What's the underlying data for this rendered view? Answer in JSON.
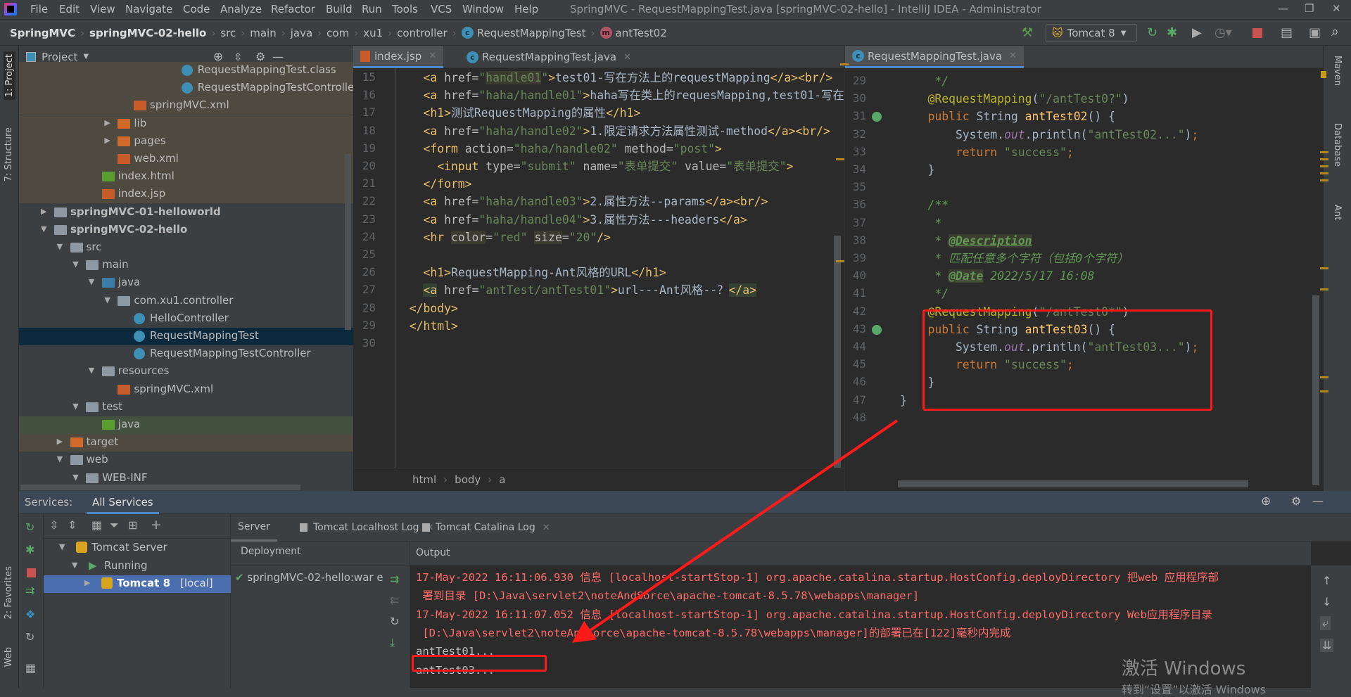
{
  "window": {
    "title": "SpringMVC - RequestMappingTest.java [springMVC-02-hello] - IntelliJ IDEA - Administrator",
    "controls": [
      "—",
      "❐",
      "✕"
    ]
  },
  "menu": [
    "File",
    "Edit",
    "View",
    "Navigate",
    "Code",
    "Analyze",
    "Refactor",
    "Build",
    "Run",
    "Tools",
    "VCS",
    "Window",
    "Help"
  ],
  "breadcrumb": [
    "SpringMVC",
    "springMVC-02-hello",
    "src",
    "main",
    "java",
    "com",
    "xu1",
    "controller",
    "RequestMappingTest",
    "antTest02"
  ],
  "run_config": "Tomcat 8",
  "left_strip": {
    "project": "1: Project",
    "structure": "7: Structure",
    "favorites": "2: Favorites",
    "web": "Web"
  },
  "right_strip": [
    "Maven",
    "Database",
    "Ant"
  ],
  "project": {
    "title": "Project",
    "rows": [
      {
        "label": "RequestMappingTest.class",
        "depth": 8,
        "icon": "class",
        "bg": "excl"
      },
      {
        "label": "RequestMappingTestController",
        "depth": 8,
        "icon": "class",
        "bg": "excl"
      },
      {
        "label": "springMVC.xml",
        "depth": 5,
        "icon": "xml",
        "bg": "excl"
      },
      {
        "label": "lib",
        "depth": 4,
        "icon": "folder-orange",
        "arrow": "▶",
        "bg": "excl"
      },
      {
        "label": "pages",
        "depth": 4,
        "icon": "folder-orange",
        "arrow": "▶",
        "bg": "excl"
      },
      {
        "label": "web.xml",
        "depth": 4,
        "icon": "xml",
        "bg": "excl"
      },
      {
        "label": "index.html",
        "depth": 3,
        "icon": "html",
        "bg": "excl"
      },
      {
        "label": "index.jsp",
        "depth": 3,
        "icon": "jsp",
        "bg": "excl"
      },
      {
        "label": "springMVC-01-helloworld",
        "depth": 0,
        "icon": "module",
        "arrow": "▶",
        "bold": true
      },
      {
        "label": "springMVC-02-hello",
        "depth": 0,
        "icon": "module",
        "arrow": "▼",
        "bold": true
      },
      {
        "label": "src",
        "depth": 1,
        "icon": "folder",
        "arrow": "▼"
      },
      {
        "label": "main",
        "depth": 2,
        "icon": "folder",
        "arrow": "▼"
      },
      {
        "label": "java",
        "depth": 3,
        "icon": "folder-blue",
        "arrow": "▼"
      },
      {
        "label": "com.xu1.controller",
        "depth": 4,
        "icon": "package",
        "arrow": "▼"
      },
      {
        "label": "HelloController",
        "depth": 5,
        "icon": "class"
      },
      {
        "label": "RequestMappingTest",
        "depth": 5,
        "icon": "class",
        "bg": "sel"
      },
      {
        "label": "RequestMappingTestController",
        "depth": 5,
        "icon": "class"
      },
      {
        "label": "resources",
        "depth": 3,
        "icon": "folder",
        "arrow": "▼"
      },
      {
        "label": "springMVC.xml",
        "depth": 4,
        "icon": "xml"
      },
      {
        "label": "test",
        "depth": 2,
        "icon": "folder",
        "arrow": "▼"
      },
      {
        "label": "java",
        "depth": 3,
        "icon": "folder-green",
        "bg": "test"
      },
      {
        "label": "target",
        "depth": 1,
        "icon": "folder-orange",
        "arrow": "▶",
        "bg": "excl"
      },
      {
        "label": "web",
        "depth": 1,
        "icon": "folder",
        "arrow": "▼"
      },
      {
        "label": "WEB-INF",
        "depth": 2,
        "icon": "folder",
        "arrow": "▼"
      }
    ]
  },
  "left_editor": {
    "tabs": [
      {
        "label": "index.jsp",
        "active": true
      },
      {
        "label": "RequestMappingTest.java"
      }
    ],
    "breadcrumb": [
      "html",
      "body",
      "a"
    ],
    "lines": [
      {
        "n": 15,
        "tokens": [
          [
            "t",
            "    <a "
          ],
          [
            "a",
            "href="
          ],
          [
            "s",
            "\""
          ],
          [
            "s hl",
            "handle01"
          ],
          [
            "s",
            "\""
          ],
          [
            "t",
            ">"
          ],
          [
            "x",
            "test01-写在方法上的requestMapping"
          ],
          [
            "t",
            "</a><br/>"
          ]
        ]
      },
      {
        "n": 16,
        "tokens": [
          [
            "t",
            "    <a "
          ],
          [
            "a",
            "href="
          ],
          [
            "s",
            "\"haha/handle01\""
          ],
          [
            "t",
            ">"
          ],
          [
            "x",
            "haha写在类上的requesMapping,test01-写在"
          ]
        ]
      },
      {
        "n": 17,
        "tokens": [
          [
            "t",
            "    <h1>"
          ],
          [
            "x",
            "测试RequestMapping的属性"
          ],
          [
            "t",
            "</h1>"
          ]
        ]
      },
      {
        "n": 18,
        "tokens": [
          [
            "t",
            "    <a "
          ],
          [
            "a",
            "href="
          ],
          [
            "s",
            "\"haha/handle02\""
          ],
          [
            "t",
            ">"
          ],
          [
            "x",
            "1.限定请求方法属性测试-method"
          ],
          [
            "t",
            "</a><br/>"
          ]
        ]
      },
      {
        "n": 19,
        "tokens": [
          [
            "t",
            "    <form "
          ],
          [
            "a",
            "action="
          ],
          [
            "s",
            "\"haha/handle02\""
          ],
          [
            "a",
            " method="
          ],
          [
            "s",
            "\"post\""
          ],
          [
            "t",
            ">"
          ]
        ]
      },
      {
        "n": 20,
        "tokens": [
          [
            "t",
            "      <input "
          ],
          [
            "a",
            "type="
          ],
          [
            "s",
            "\"submit\""
          ],
          [
            "a",
            " name="
          ],
          [
            "s",
            "\"表单提交\""
          ],
          [
            "a",
            " value="
          ],
          [
            "s",
            "\"表单提交\""
          ],
          [
            "t",
            ">"
          ]
        ]
      },
      {
        "n": 21,
        "tokens": [
          [
            "t",
            "    </form>"
          ]
        ]
      },
      {
        "n": 22,
        "tokens": [
          [
            "t",
            "    <a "
          ],
          [
            "a",
            "href="
          ],
          [
            "s",
            "\"haha/handle03\""
          ],
          [
            "t",
            ">"
          ],
          [
            "x",
            "2.属性方法--params"
          ],
          [
            "t",
            "</a><br/>"
          ]
        ]
      },
      {
        "n": 23,
        "tokens": [
          [
            "t",
            "    <a "
          ],
          [
            "a",
            "href="
          ],
          [
            "s",
            "\"haha/handle04\""
          ],
          [
            "t",
            ">"
          ],
          [
            "x",
            "3.属性方法---headers"
          ],
          [
            "t",
            "</a>"
          ]
        ]
      },
      {
        "n": 24,
        "tokens": [
          [
            "t",
            "    <hr "
          ],
          [
            "a hl",
            "color"
          ],
          [
            "a",
            "="
          ],
          [
            "s",
            "\"red\" "
          ],
          [
            "a hl",
            "size"
          ],
          [
            "a",
            "="
          ],
          [
            "s",
            "\"20\""
          ],
          [
            "t",
            "/>"
          ]
        ]
      },
      {
        "n": 25,
        "tokens": []
      },
      {
        "n": 26,
        "tokens": [
          [
            "t",
            "    <h1>"
          ],
          [
            "x",
            "RequestMapping-Ant风格的URL"
          ],
          [
            "t",
            "</h1>"
          ]
        ]
      },
      {
        "n": 27,
        "tokens": [
          [
            "t",
            "    "
          ],
          [
            "t hl2",
            "<a"
          ],
          [
            "a",
            " href="
          ],
          [
            "s",
            "\"antTest/antTest01\""
          ],
          [
            "t",
            ">"
          ],
          [
            "x",
            "url---Ant风格--？"
          ],
          [
            "t hl2",
            "</a>"
          ]
        ]
      },
      {
        "n": 28,
        "tokens": [
          [
            "t",
            "  </body>"
          ]
        ]
      },
      {
        "n": 29,
        "tokens": [
          [
            "t",
            "  </html>"
          ]
        ]
      },
      {
        "n": 30,
        "tokens": []
      }
    ]
  },
  "right_editor": {
    "tabs": [
      {
        "label": "RequestMappingTest.java",
        "active": true
      }
    ],
    "lines": [
      {
        "n": 29,
        "tokens": [
          [
            "c",
            "     */"
          ]
        ]
      },
      {
        "n": 30,
        "tokens": [
          [
            "an",
            "    @RequestMapping"
          ],
          [
            "x",
            "("
          ],
          [
            "s",
            "\"/antTest0?\""
          ],
          [
            "x",
            ")"
          ]
        ]
      },
      {
        "n": 31,
        "tokens": [
          [
            "k",
            "    public "
          ],
          [
            "x",
            "String "
          ],
          [
            "f",
            "antTest02"
          ],
          [
            "x",
            "() {"
          ]
        ]
      },
      {
        "n": 32,
        "tokens": [
          [
            "x",
            "        System."
          ],
          [
            "i",
            "out"
          ],
          [
            "x",
            ".println("
          ],
          [
            "s",
            "\"antTest02...\""
          ],
          [
            "x",
            ")"
          ],
          [
            "k",
            ";"
          ]
        ]
      },
      {
        "n": 33,
        "tokens": [
          [
            "k",
            "        return "
          ],
          [
            "s",
            "\"success\""
          ],
          [
            "k",
            ";"
          ]
        ]
      },
      {
        "n": 34,
        "tokens": [
          [
            "x",
            "    }"
          ]
        ]
      },
      {
        "n": 35,
        "tokens": []
      },
      {
        "n": 36,
        "tokens": [
          [
            "c",
            "    /**"
          ]
        ]
      },
      {
        "n": 37,
        "tokens": [
          [
            "c",
            "     *"
          ]
        ]
      },
      {
        "n": 38,
        "tokens": [
          [
            "c",
            "     * "
          ],
          [
            "dt",
            "@Description"
          ]
        ]
      },
      {
        "n": 39,
        "tokens": [
          [
            "c",
            "     * 匹配任意多个字符（包括0个字符）"
          ]
        ]
      },
      {
        "n": 40,
        "tokens": [
          [
            "c",
            "     * "
          ],
          [
            "dt",
            "@Date"
          ],
          [
            "c",
            " 2022/5/17 16:08"
          ]
        ]
      },
      {
        "n": 41,
        "tokens": [
          [
            "c",
            "     */"
          ]
        ]
      },
      {
        "n": 42,
        "tokens": [
          [
            "an",
            "    @RequestMapping"
          ],
          [
            "x",
            "("
          ],
          [
            "s",
            "\"/antTest0*\""
          ],
          [
            "x",
            ")"
          ]
        ]
      },
      {
        "n": 43,
        "tokens": [
          [
            "k",
            "    public "
          ],
          [
            "x",
            "String "
          ],
          [
            "f",
            "antTest03"
          ],
          [
            "x",
            "() {"
          ]
        ]
      },
      {
        "n": 44,
        "tokens": [
          [
            "x",
            "        System."
          ],
          [
            "i",
            "out"
          ],
          [
            "x",
            ".println("
          ],
          [
            "s",
            "\"antTest03...\""
          ],
          [
            "x",
            ")"
          ],
          [
            "k",
            ";"
          ]
        ]
      },
      {
        "n": 45,
        "tokens": [
          [
            "k",
            "        return "
          ],
          [
            "s",
            "\"success\""
          ],
          [
            "k",
            ";"
          ]
        ]
      },
      {
        "n": 46,
        "tokens": [
          [
            "x",
            "    }"
          ]
        ]
      },
      {
        "n": 47,
        "tokens": [
          [
            "x",
            "}"
          ]
        ]
      },
      {
        "n": 48,
        "tokens": []
      }
    ]
  },
  "services": {
    "label": "Services:",
    "tab": "All Services",
    "tree": [
      {
        "label": "Tomcat Server",
        "arrow": "▼"
      },
      {
        "label": "Running",
        "arrow": "▼"
      },
      {
        "label": "Tomcat 8",
        "suffix": "[local]",
        "arrow": "▶"
      }
    ],
    "tabs": [
      "Server",
      "Tomcat Localhost Log",
      "Tomcat Catalina Log"
    ],
    "deployment_header": "Deployment",
    "deployment_item": "springMVC-02-hello:war e:",
    "output_header": "Output",
    "output": [
      {
        "text": "17-May-2022 16:11:06.930 信息 [localhost-startStop-1] org.apache.catalina.startup.HostConfig.deployDirectory 把web 应用程序部",
        "red": true
      },
      {
        "text": " 署到目录 [D:\\Java\\servlet2\\noteAndSorce\\apache-tomcat-8.5.78\\webapps\\manager]",
        "red": true
      },
      {
        "text": "17-May-2022 16:11:07.052 信息 [localhost-startStop-1] org.apache.catalina.startup.HostConfig.deployDirectory Web应用程序目录",
        "red": true
      },
      {
        "text": " [D:\\Java\\servlet2\\noteAndSorce\\apache-tomcat-8.5.78\\webapps\\manager]的部署已在[122]毫秒内完成",
        "red": true
      },
      {
        "text": "antTest01...",
        "red": false
      },
      {
        "text": "antTest03...",
        "red": false
      }
    ]
  },
  "watermark": {
    "line1": "激活 Windows",
    "line2": "转到“设置”以激活 Windows"
  },
  "colors": {
    "annotation_red": "#ff1a1a",
    "accent": "#4a88c7"
  }
}
